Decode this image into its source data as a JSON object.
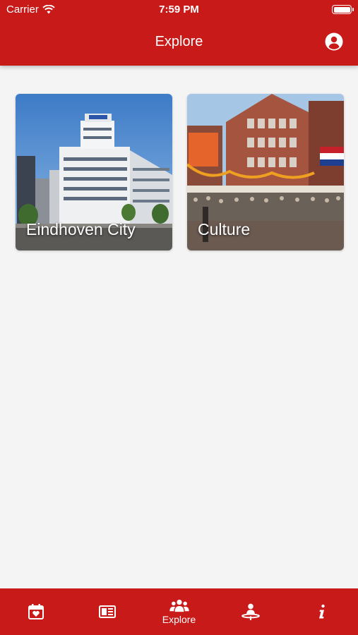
{
  "status": {
    "carrier": "Carrier",
    "time": "7:59 PM",
    "battery_level": 1.0
  },
  "header": {
    "title": "Explore",
    "profile_icon": "account-circle-icon"
  },
  "cards": [
    {
      "label": "Eindhoven City"
    },
    {
      "label": "Culture"
    }
  ],
  "tabbar": {
    "items": [
      {
        "icon": "calendar-heart-icon",
        "label": ""
      },
      {
        "icon": "newspaper-icon",
        "label": ""
      },
      {
        "icon": "group-icon",
        "label": "Explore",
        "active": true
      },
      {
        "icon": "person-pin-icon",
        "label": ""
      },
      {
        "icon": "info-icon",
        "label": ""
      }
    ]
  },
  "colors": {
    "accent": "#c91a1a",
    "background": "#f4f4f4"
  }
}
